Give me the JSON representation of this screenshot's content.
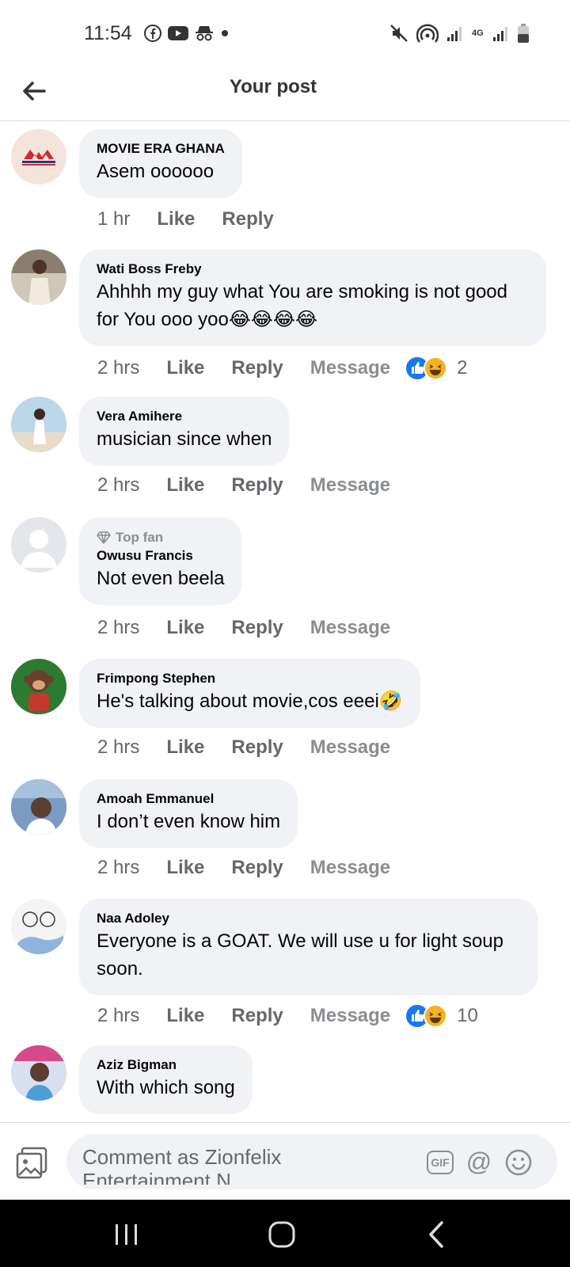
{
  "status": {
    "time": "11:54",
    "network": "4G"
  },
  "header": {
    "title": "Your post"
  },
  "actions": {
    "like": "Like",
    "reply": "Reply",
    "message": "Message"
  },
  "comments": [
    {
      "author": "MOVIE ERA GHANA",
      "text": "Asem oooooo",
      "time": "1 hr"
    },
    {
      "author": "Wati Boss Freby",
      "text": "Ahhhh my guy what You are smoking is not good for You ooo yoo😂😂😂😂",
      "time": "2 hrs",
      "reactions": "2"
    },
    {
      "author": "Vera Amihere",
      "text": "musician since when",
      "time": "2 hrs"
    },
    {
      "badge": "Top fan",
      "author": "Owusu Francis",
      "text": "Not even beela",
      "time": "2 hrs"
    },
    {
      "author": "Frimpong Stephen",
      "text": "He's talking about movie,cos eeei🤣",
      "time": "2 hrs"
    },
    {
      "author": "Amoah Emmanuel",
      "text": "I don’t even know him",
      "time": "2 hrs"
    },
    {
      "author": "Naa Adoley",
      "text": "Everyone is a GOAT. We will use u for light soup soon.",
      "time": "2 hrs",
      "reactions": "10"
    },
    {
      "author": "Aziz Bigman",
      "text": "With which song"
    }
  ],
  "composer": {
    "placeholder": "Comment as Zionfelix Entertainment N...",
    "gif_label": "GIF",
    "at_label": "@"
  },
  "colors": {
    "bubble": "#f0f2f5",
    "like_blue": "#1877f2",
    "secondary_text": "#65676b"
  }
}
